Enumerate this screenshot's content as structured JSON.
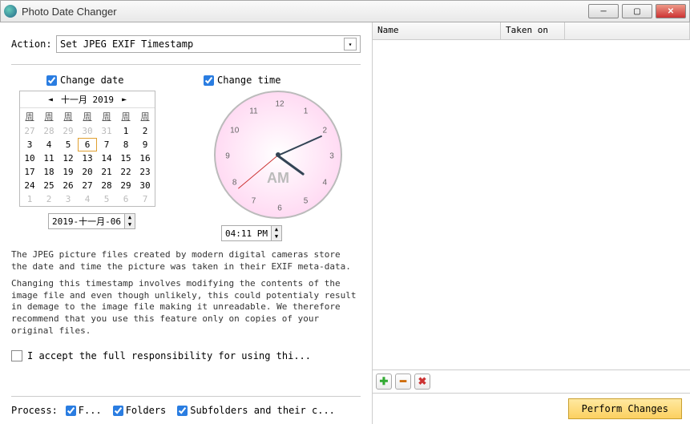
{
  "window": {
    "title": "Photo Date Changer"
  },
  "action": {
    "label": "Action:",
    "selected": "Set JPEG EXIF Timestamp"
  },
  "change_date": {
    "label": "Change date",
    "checked": true
  },
  "change_time": {
    "label": "Change time",
    "checked": true
  },
  "calendar": {
    "title": "十一月 2019",
    "weekdays": [
      "周",
      "周",
      "周",
      "周",
      "周",
      "周",
      "周"
    ],
    "rows": [
      [
        {
          "d": "27",
          "m": true
        },
        {
          "d": "28",
          "m": true
        },
        {
          "d": "29",
          "m": true
        },
        {
          "d": "30",
          "m": true
        },
        {
          "d": "31",
          "m": true
        },
        {
          "d": "1"
        },
        {
          "d": "2"
        }
      ],
      [
        {
          "d": "3"
        },
        {
          "d": "4"
        },
        {
          "d": "5"
        },
        {
          "d": "6",
          "sel": true
        },
        {
          "d": "7"
        },
        {
          "d": "8"
        },
        {
          "d": "9"
        }
      ],
      [
        {
          "d": "10"
        },
        {
          "d": "11"
        },
        {
          "d": "12"
        },
        {
          "d": "13"
        },
        {
          "d": "14"
        },
        {
          "d": "15"
        },
        {
          "d": "16"
        }
      ],
      [
        {
          "d": "17"
        },
        {
          "d": "18"
        },
        {
          "d": "19"
        },
        {
          "d": "20"
        },
        {
          "d": "21"
        },
        {
          "d": "22"
        },
        {
          "d": "23"
        }
      ],
      [
        {
          "d": "24"
        },
        {
          "d": "25"
        },
        {
          "d": "26"
        },
        {
          "d": "27"
        },
        {
          "d": "28"
        },
        {
          "d": "29"
        },
        {
          "d": "30"
        }
      ],
      [
        {
          "d": "1",
          "m": true
        },
        {
          "d": "2",
          "m": true
        },
        {
          "d": "3",
          "m": true
        },
        {
          "d": "4",
          "m": true
        },
        {
          "d": "5",
          "m": true
        },
        {
          "d": "6",
          "m": true
        },
        {
          "d": "7",
          "m": true
        }
      ]
    ]
  },
  "date_value": "2019-十一月-06",
  "time_value": "04:11 PM",
  "clock": {
    "ampm": "AM",
    "numbers": [
      "12",
      "1",
      "2",
      "3",
      "4",
      "5",
      "6",
      "7",
      "8",
      "9",
      "10",
      "11"
    ]
  },
  "description": {
    "p1": "The JPEG picture files created by modern digital cameras store the date and time the picture was taken in their EXIF meta-data.",
    "p2": "Changing this timestamp involves modifying the contents of the image file and even though unlikely, this could potentialy result in demage to the image file making it unreadable. We therefore recommend that you use this feature only on copies of your original files."
  },
  "accept": {
    "label": "I accept the full responsibility for using thi..."
  },
  "process": {
    "label": "Process:",
    "items": [
      {
        "label": "F...",
        "checked": true
      },
      {
        "label": "Folders",
        "checked": true
      },
      {
        "label": "Subfolders and their c...",
        "checked": true
      }
    ]
  },
  "table": {
    "columns": [
      "Name",
      "Taken on",
      ""
    ]
  },
  "buttons": {
    "perform": "Perform Changes"
  }
}
